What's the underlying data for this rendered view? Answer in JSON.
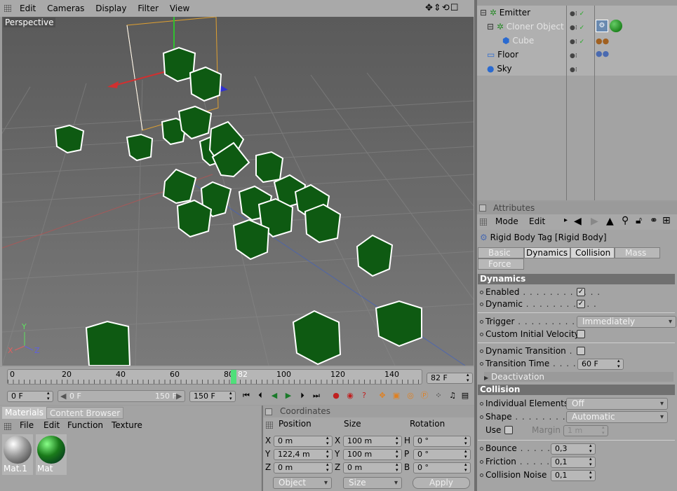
{
  "viewport_menu": {
    "items": [
      "Edit",
      "Cameras",
      "Display",
      "Filter",
      "View"
    ]
  },
  "viewport": {
    "label": "Perspective",
    "axis_labels": {
      "y": "Y",
      "x": "X",
      "z": "Z"
    }
  },
  "object_manager": {
    "objects": [
      {
        "name": "Emitter",
        "icon": "emitter-icon",
        "dimmed": false
      },
      {
        "name": "Cloner Object",
        "icon": "cloner-icon",
        "dimmed": true
      },
      {
        "name": "Cube",
        "icon": "cube-icon",
        "dimmed": true
      },
      {
        "name": "Floor",
        "icon": "floor-icon",
        "dimmed": false
      },
      {
        "name": "Sky",
        "icon": "sky-icon",
        "dimmed": false
      }
    ]
  },
  "attributes": {
    "title": "Attributes",
    "menu": [
      "Mode",
      "Edit"
    ],
    "object_title": "Rigid Body Tag [Rigid Body]",
    "tabs": [
      "Basic",
      "Dynamics",
      "Collision",
      "Mass",
      "Force"
    ],
    "active_tabs": [
      "Dynamics",
      "Collision"
    ],
    "dynamics_header": "Dynamics",
    "enabled_label": "Enabled",
    "dynamic_label": "Dynamic",
    "trigger_label": "Trigger",
    "trigger_value": "Immediately",
    "civ_label": "Custom Initial Velocity",
    "dyn_transition_label": "Dynamic Transition",
    "transition_time_label": "Transition Time",
    "transition_time_value": "60 F",
    "deactivation_label": "Deactivation",
    "collision_header": "Collision",
    "individual_label": "Individual Elements",
    "individual_value": "Off",
    "shape_label": "Shape",
    "shape_value": "Automatic",
    "use_label": "Use",
    "margin_label": "Margin",
    "margin_value": "1 m",
    "bounce_label": "Bounce",
    "bounce_value": "0,3",
    "friction_label": "Friction",
    "friction_value": "0,1",
    "noise_label": "Collision Noise",
    "noise_value": "0,1"
  },
  "timeline": {
    "ticks": [
      "0",
      "20",
      "40",
      "60",
      "80",
      "82",
      "100",
      "120",
      "140"
    ],
    "current_frame": "82 F",
    "start_field": "0 F",
    "range_start": "0 F",
    "range_end": "150 F",
    "end_field": "150 F"
  },
  "materials": {
    "tabs": [
      "Materials",
      "Content Browser"
    ],
    "menu": [
      "File",
      "Edit",
      "Function",
      "Texture"
    ],
    "items": [
      {
        "name": "Mat.1"
      },
      {
        "name": "Mat"
      }
    ]
  },
  "coordinates": {
    "title": "Coordinates",
    "headers": [
      "Position",
      "Size",
      "Rotation"
    ],
    "rows": [
      {
        "pl": "X",
        "pv": "0 m",
        "sl": "X",
        "sv": "100 m",
        "rl": "H",
        "rv": "0 °"
      },
      {
        "pl": "Y",
        "pv": "122,4 m",
        "sl": "Y",
        "sv": "100 m",
        "rl": "P",
        "rv": "0 °"
      },
      {
        "pl": "Z",
        "pv": "0 m",
        "sl": "Z",
        "sv": "0 m",
        "rl": "B",
        "rv": "0 °"
      }
    ],
    "object_mode": "Object",
    "size_mode": "Size",
    "apply": "Apply"
  }
}
